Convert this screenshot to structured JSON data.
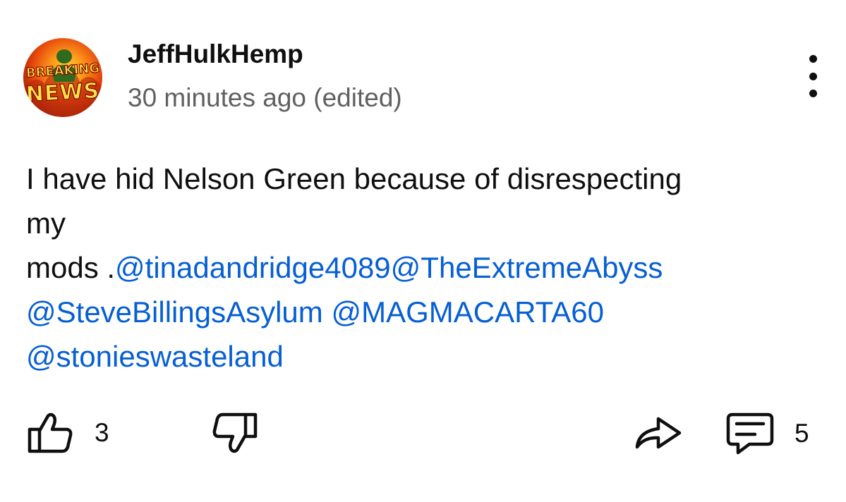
{
  "comment": {
    "avatar_text_top": "BREAKING",
    "avatar_text_bottom": "NEWS",
    "author": "JeffHulkHemp",
    "timestamp": "30 minutes ago (edited)",
    "body_line1": "I have hid Nelson Green because of disrespecting",
    "body_line2": "my",
    "body_line3_text": "mods .",
    "mentions": [
      "@tinadandridge4089",
      "@TheExtremeAbyss",
      "@SteveBillingsAsylum",
      "@MAGMACARTA60",
      "@stonieswasteland"
    ],
    "actions": {
      "like_icon": "thumbs-up-icon",
      "like_count": "3",
      "dislike_icon": "thumbs-down-icon",
      "share_icon": "share-icon",
      "replies_icon": "comment-icon",
      "reply_count": "5",
      "more_icon": "more-vertical-icon"
    }
  },
  "colors": {
    "text": "#0f0f0f",
    "secondary_text": "#606060",
    "link": "#065fd4",
    "background": "#ffffff"
  }
}
